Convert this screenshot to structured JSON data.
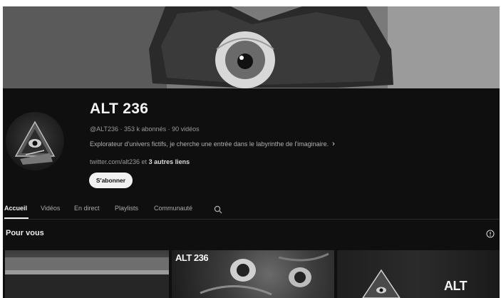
{
  "channel": {
    "name": "ALT 236",
    "handle": "@ALT236",
    "subscribers": "353 k abonnés",
    "videos": "90 vidéos",
    "separator": "·",
    "description": "Explorateur d'univers fictifs, je cherche une entrée dans le labyrinthe de l'imaginaire.",
    "links_prefix": "twitter.com/alt236 et",
    "links_more": "3 autres liens",
    "subscribe_label": "S'abonner"
  },
  "tabs": [
    {
      "label": "Accueil",
      "active": true
    },
    {
      "label": "Vidéos",
      "active": false
    },
    {
      "label": "En direct",
      "active": false
    },
    {
      "label": "Playlists",
      "active": false
    },
    {
      "label": "Communauté",
      "active": false
    }
  ],
  "section": {
    "title": "Pour vous"
  },
  "thumbnails": [
    {
      "overlay": ""
    },
    {
      "overlay": "ALT 236"
    },
    {
      "overlay": "ALT"
    }
  ],
  "icons": {
    "search": "search-icon",
    "chevron": "chevron-right-icon",
    "play_all": "play-all-icon"
  },
  "colors": {
    "background": "#0f0f0f",
    "text": "#f1f1f1",
    "muted": "#aaaaaa",
    "button": "#f1f1f1"
  }
}
